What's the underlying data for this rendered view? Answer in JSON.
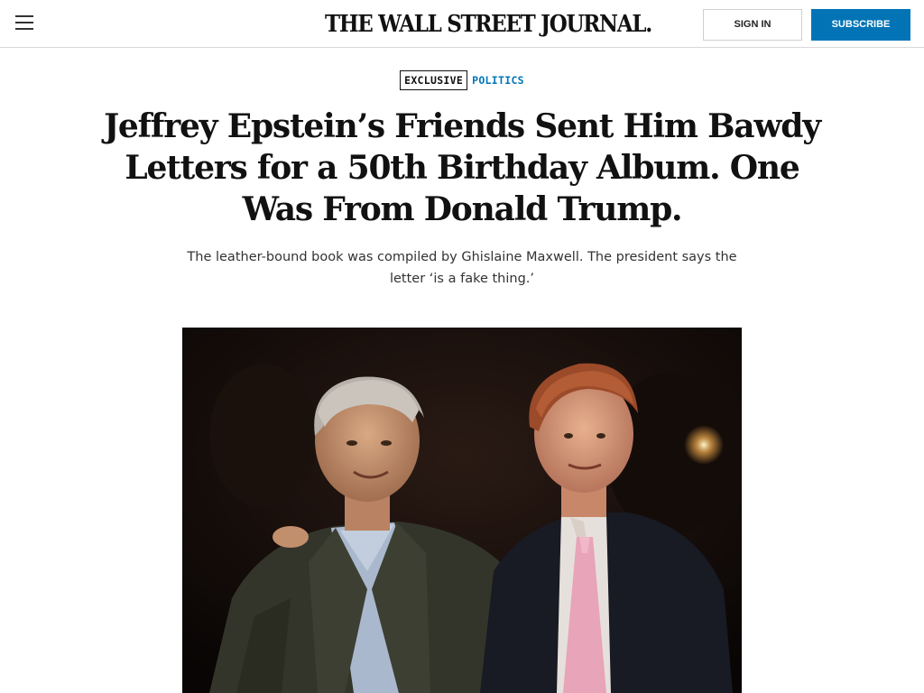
{
  "header": {
    "menu_icon": "hamburger-menu-icon",
    "logo_text": "THE WALL STREET JOURNAL.",
    "sign_in_label": "SIGN IN",
    "subscribe_label": "SUBSCRIBE",
    "subscribe_color": "#0274b6"
  },
  "article": {
    "exclusive_label": "EXCLUSIVE",
    "section_label": "POLITICS",
    "section_color": "#0274b6",
    "headline": "Jeffrey Epstein’s Friends Sent Him Bawdy Letters for a 50th Birthday Album. One Was From Donald Trump.",
    "dek": "The leather-bound book was compiled by Ghislaine Maxwell. The president says the letter ‘is a fake thing.’"
  }
}
